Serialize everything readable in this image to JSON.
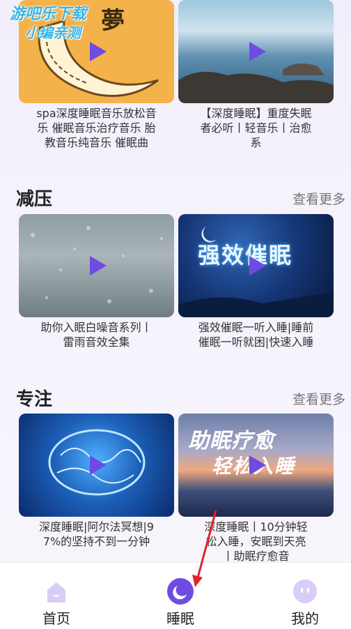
{
  "watermark": {
    "line1": "游吧乐下载",
    "line2": "小编亲测"
  },
  "top_cards": [
    {
      "caption": "spa深度睡眠音乐放松音乐 催眠音乐治疗音乐 胎教音乐纯音乐 催眠曲",
      "thumb_text": "夢"
    },
    {
      "caption": "【深度睡眠】重度失眠者必听丨轻音乐丨治愈系"
    }
  ],
  "sections": [
    {
      "title": "减压",
      "more": "查看更多",
      "cards": [
        {
          "caption": "助你入眠白噪音系列丨雷雨音效全集"
        },
        {
          "caption": "强效催眠一听入睡|睡前催眠一听就困|快速入睡",
          "thumb_text": "强效催眠"
        }
      ]
    },
    {
      "title": "专注",
      "more": "查看更多",
      "cards": [
        {
          "caption": "深度睡眠|阿尔法冥想|97%的坚持不到一分钟"
        },
        {
          "caption": "深度睡眠丨10分钟轻松入睡，安眠到天亮丨助眠疗愈音",
          "thumb_text_1": "助眠疗愈",
          "thumb_text_2": "轻松入睡"
        }
      ]
    }
  ],
  "nav": [
    {
      "label": "首页",
      "icon": "home-icon",
      "active": false
    },
    {
      "label": "睡眠",
      "icon": "moon-icon",
      "active": true
    },
    {
      "label": "我的",
      "icon": "profile-face-icon",
      "active": false
    }
  ],
  "colors": {
    "accent": "#6e4ce4",
    "inactive_icon": "#d9cdf7",
    "arrow": "#e0242a"
  }
}
